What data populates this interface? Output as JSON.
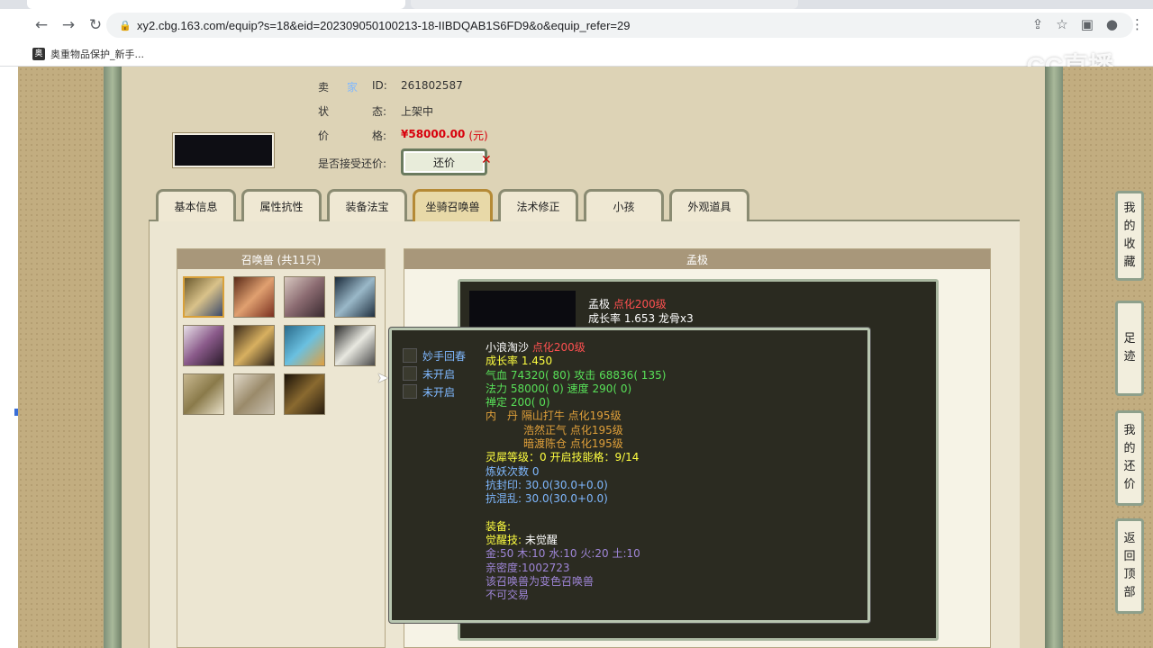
{
  "browser": {
    "url": "xy2.cbg.163.com/equip?s=18&eid=202309050100213-18-IIBDQAB1S6FD9&o&equip_refer=29",
    "bookmark_label": "奥重物品保护_新手..."
  },
  "watermark": "CC直播",
  "seller": {
    "seller_label": [
      "卖",
      "家"
    ],
    "seller_id_label": "ID:",
    "seller_id": "261802587",
    "status_label": [
      "状",
      "态:"
    ],
    "status_value": "上架中",
    "price_label": [
      "价",
      "格:"
    ],
    "price_value": "¥58000.00",
    "price_unit": "(元)",
    "counter_label": "是否接受还价:",
    "counter_button": "还价"
  },
  "tabs": [
    "基本信息",
    "属性抗性",
    "装备法宝",
    "坐骑召唤兽",
    "法术修正",
    "小孩",
    "外观道具"
  ],
  "active_tab": 3,
  "pets_panel": {
    "title": "召唤兽 (共11只)"
  },
  "detail_panel": {
    "title": "孟极",
    "card_name": "孟极",
    "card_name_tag": "点化200级",
    "card_growth": "成长率 1.653 龙骨x3"
  },
  "tooltip": {
    "skills": [
      "妙手回春",
      "未开启",
      "未开启"
    ],
    "name": "小浪淘沙",
    "name_tag": "点化200级",
    "growth": "成长率 1.450",
    "hp_label": "气血",
    "hp": "74320( 80)",
    "atk_label": "攻击",
    "atk": "68836( 135)",
    "mp_label": "法力",
    "mp": "58000( 0)",
    "spd_label": "速度",
    "spd": "290( 0)",
    "zen_label": "禅定",
    "zen": "200( 0)",
    "neidan_label": "内　丹",
    "neidan": [
      "隔山打牛 点化195级",
      "浩然正气 点化195级",
      "暗渡陈仓 点化195级"
    ],
    "lingxi": "灵犀等级：0 开启技能格：9/14",
    "lianyao": "炼妖次数 0",
    "kangfengyin_label": "抗封印:",
    "kangfengyin": "30.0(30.0+0.0)",
    "kanghunluan_label": "抗混乱:",
    "kanghunluan": "30.0(30.0+0.0)",
    "equip_label": "装备:",
    "awaken_label": "觉醒技:",
    "awaken_value": "未觉醒",
    "elements": "金:50 木:10 水:10 火:20 土:10",
    "intimacy": "亲密度:1002723",
    "variant": "该召唤兽为变色召唤兽",
    "tradable": "不可交易"
  },
  "side_buttons": [
    {
      "label": "我的收藏",
      "chars": [
        "我",
        "的",
        "收",
        "藏"
      ]
    },
    {
      "label": "足迹",
      "chars": [
        "足",
        "迹"
      ]
    },
    {
      "label": "我的还价",
      "chars": [
        "我",
        "的",
        "还",
        "价"
      ]
    },
    {
      "label": "返回顶部",
      "chars": [
        "返",
        "回",
        "顶",
        "部"
      ]
    }
  ],
  "colors": {
    "accent_red": "#d8000c",
    "tab_active_border": "#b58a36",
    "panel_header": "#a8977a"
  }
}
